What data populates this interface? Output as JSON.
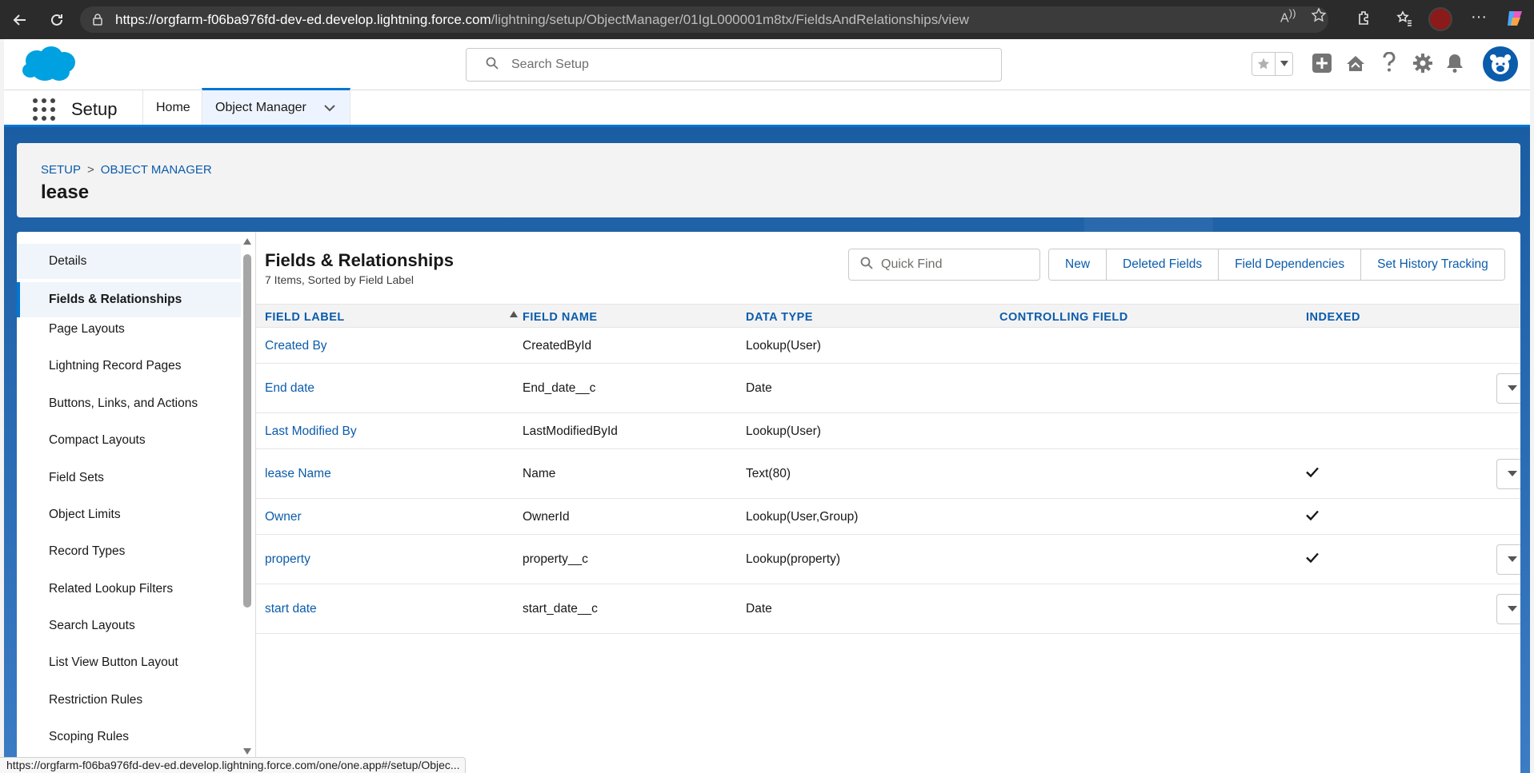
{
  "browser": {
    "url_host": "https://orgfarm-f06ba976fd-dev-ed.develop.lightning.force.com",
    "url_path": "/lightning/setup/ObjectManager/01IgL000001m8tx/FieldsAndRelationships/view",
    "status_url": "https://orgfarm-f06ba976fd-dev-ed.develop.lightning.force.com/one/one.app#/setup/Objec..."
  },
  "header": {
    "search_placeholder": "Search Setup"
  },
  "app_nav": {
    "app_name": "Setup",
    "tabs": [
      {
        "label": "Home"
      },
      {
        "label": "Object Manager"
      }
    ]
  },
  "page_header": {
    "breadcrumb": [
      "SETUP",
      "OBJECT MANAGER"
    ],
    "breadcrumb_sep": ">",
    "title": "lease"
  },
  "sidebar": {
    "items": [
      {
        "label": "Details"
      },
      {
        "label": "Fields & Relationships"
      },
      {
        "label": "Page Layouts"
      },
      {
        "label": "Lightning Record Pages"
      },
      {
        "label": "Buttons, Links, and Actions"
      },
      {
        "label": "Compact Layouts"
      },
      {
        "label": "Field Sets"
      },
      {
        "label": "Object Limits"
      },
      {
        "label": "Record Types"
      },
      {
        "label": "Related Lookup Filters"
      },
      {
        "label": "Search Layouts"
      },
      {
        "label": "List View Button Layout"
      },
      {
        "label": "Restriction Rules"
      },
      {
        "label": "Scoping Rules"
      }
    ],
    "active_index": 1
  },
  "content": {
    "title": "Fields & Relationships",
    "subtitle": "7 Items, Sorted by Field Label",
    "quick_find_placeholder": "Quick Find",
    "buttons": [
      "New",
      "Deleted Fields",
      "Field Dependencies",
      "Set History Tracking"
    ],
    "columns": [
      "FIELD LABEL",
      "FIELD NAME",
      "DATA TYPE",
      "CONTROLLING FIELD",
      "INDEXED"
    ],
    "rows": [
      {
        "label": "Created By",
        "name": "CreatedById",
        "type": "Lookup(User)",
        "controlling": "",
        "indexed": false,
        "menu": false
      },
      {
        "label": "End date",
        "name": "End_date__c",
        "type": "Date",
        "controlling": "",
        "indexed": false,
        "menu": true
      },
      {
        "label": "Last Modified By",
        "name": "LastModifiedById",
        "type": "Lookup(User)",
        "controlling": "",
        "indexed": false,
        "menu": false
      },
      {
        "label": "lease Name",
        "name": "Name",
        "type": "Text(80)",
        "controlling": "",
        "indexed": true,
        "menu": true
      },
      {
        "label": "Owner",
        "name": "OwnerId",
        "type": "Lookup(User,Group)",
        "controlling": "",
        "indexed": true,
        "menu": false
      },
      {
        "label": "property",
        "name": "property__c",
        "type": "Lookup(property)",
        "controlling": "",
        "indexed": true,
        "menu": true
      },
      {
        "label": "start date",
        "name": "start_date__c",
        "type": "Date",
        "controlling": "",
        "indexed": false,
        "menu": true
      }
    ]
  },
  "colors": {
    "brand_blue": "#0176d3",
    "link_blue": "#0b5cab",
    "salesforce_cloud": "#00a1e0"
  }
}
